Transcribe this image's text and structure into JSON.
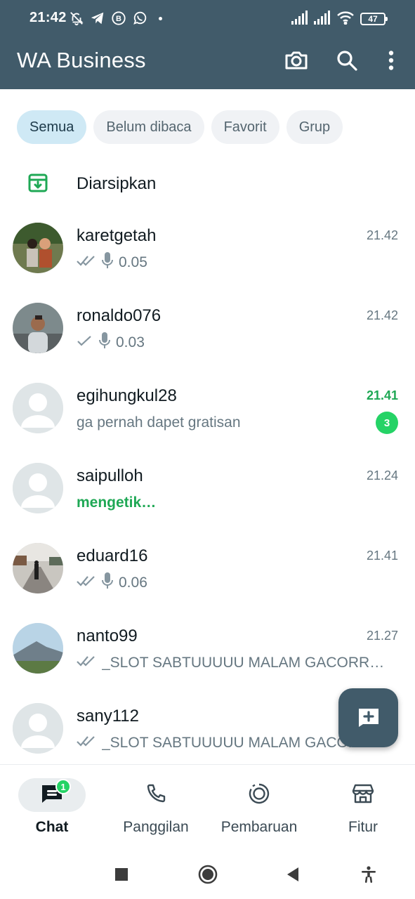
{
  "status_bar": {
    "time": "21:42",
    "battery": "47",
    "icons": [
      "muted-ringer-icon",
      "telegram-icon",
      "b-app-icon",
      "whatsapp-icon",
      "dot-icon",
      "signal-icon",
      "signal-icon",
      "wifi-icon",
      "battery-icon"
    ]
  },
  "header": {
    "title": "WA Business",
    "actions": [
      "camera-icon",
      "search-icon",
      "more-vert-icon"
    ]
  },
  "filters": {
    "chips": [
      "Semua",
      "Belum dibaca",
      "Favorit",
      "Grup"
    ],
    "selected": "Semua"
  },
  "archived": {
    "label": "Diarsipkan"
  },
  "chats": [
    {
      "name": "karetgetah",
      "time": "21.42",
      "preview": "0.05",
      "kind": "voice",
      "ticks": "double"
    },
    {
      "name": "ronaldo076",
      "time": "21.42",
      "preview": "0.03",
      "kind": "voice",
      "ticks": "single"
    },
    {
      "name": "egihungkul28",
      "time": "21.41",
      "preview": "ga pernah dapet gratisan",
      "kind": "text",
      "unread": "3"
    },
    {
      "name": "saipulloh",
      "time": "21.24",
      "preview": "mengetik…",
      "kind": "typing"
    },
    {
      "name": "eduard16",
      "time": "21.41",
      "preview": "0.06",
      "kind": "voice",
      "ticks": "double"
    },
    {
      "name": "nanto99",
      "time": "21.27",
      "preview": "_SLOT SABTUUUUU MALAM GACORRRRRR",
      "kind": "text",
      "ticks": "double"
    },
    {
      "name": "sany112",
      "time": "",
      "preview": "_SLOT SABTUUUUU MALAM GACORRRRRR",
      "kind": "text",
      "ticks": "double"
    }
  ],
  "fab": {
    "icon": "new-chat-icon"
  },
  "bottom_nav": {
    "items": [
      {
        "label": "Chat",
        "icon": "chat-icon",
        "badge": "1",
        "active": true
      },
      {
        "label": "Panggilan",
        "icon": "phone-icon"
      },
      {
        "label": "Pembaruan",
        "icon": "updates-icon"
      },
      {
        "label": "Fitur",
        "icon": "store-icon"
      }
    ]
  },
  "system_nav": [
    "recents-icon",
    "home-icon",
    "back-icon",
    "accessibility-icon"
  ],
  "colors": {
    "header": "#415b6a",
    "accent_green": "#25d366",
    "unread_time": "#1fa855",
    "chip_active": "#cfe9f5",
    "chip_inactive": "#f0f2f5"
  }
}
